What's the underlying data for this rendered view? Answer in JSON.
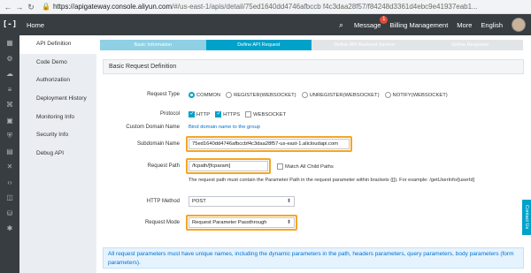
{
  "browser": {
    "url_prefix": "https://",
    "url_host": "apigateway.console.aliyun.com",
    "url_path": "/#/us-east-1/apis/detail/75ed1640dd4746afbccb f4c3daa28f57/f84248d3361d4ebc9e41937eab1..."
  },
  "topnav": {
    "logo": "[-]",
    "home": "Home",
    "message": "Message",
    "message_count": "1",
    "billing": "Billing Management",
    "more": "More",
    "language": "English"
  },
  "icons": [
    "grid-icon",
    "gear-icon",
    "cloud-icon",
    "list-icon",
    "network-icon",
    "box-icon",
    "shield-icon",
    "server-icon",
    "cross-icon",
    "code-icon",
    "layers-icon",
    "database-icon",
    "settings-icon"
  ],
  "leftmenu": {
    "items": [
      "API Definition",
      "Code Demo",
      "Authorization",
      "Deployment History",
      "Monitoring Info",
      "Security Info",
      "Debug API"
    ]
  },
  "steps": [
    "Basic Information",
    "Define API Request",
    "Define API Backend Service",
    "Define Response"
  ],
  "section_title": "Basic Request Definition",
  "form": {
    "request_type_label": "Request Type",
    "request_type_options": [
      "COMMON",
      "REGISTER(WEBSOCKET)",
      "UNREGISTER(WEBSOCKET)",
      "NOTIFY(WEBSOCKET)"
    ],
    "protocol_label": "Protocol",
    "protocol_options": [
      "HTTP",
      "HTTPS",
      "WEBSOCKET"
    ],
    "custom_domain_label": "Custom Domain Name",
    "custom_domain_link": "Bind domain name to the group",
    "subdomain_label": "Subdomain Name",
    "subdomain_value": "75ed1640dd4746afbccbf4c3daa28f57-us-east-1.alicloudapi.com",
    "request_path_label": "Request Path",
    "request_path_value": "/fcpath/[fcparam]",
    "match_all_label": "Match All Child Paths",
    "request_path_hint": "The request path must contain the Parameter Path in the request parameter within brackets ([]). For example: /getUserInfo/[userId]",
    "http_method_label": "HTTP Method",
    "http_method_value": "POST",
    "request_mode_label": "Request Mode",
    "request_mode_value": "Request Parameter Passthrough"
  },
  "info_text": "All request parameters must have unique names, including the dynamic parameters in the path, headers parameters, query parameters, body parameters (form parameters).",
  "contact_us": "Contact Us"
}
